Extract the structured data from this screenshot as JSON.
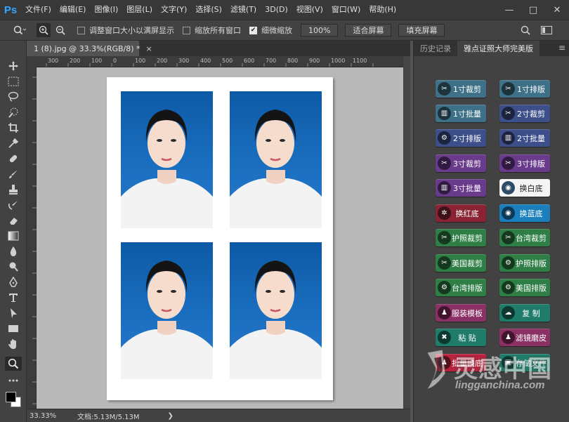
{
  "app": {
    "logo": "Ps"
  },
  "menu": [
    "文件(F)",
    "编辑(E)",
    "图像(I)",
    "图层(L)",
    "文字(Y)",
    "选择(S)",
    "滤镜(T)",
    "3D(D)",
    "视图(V)",
    "窗口(W)",
    "帮助(H)"
  ],
  "window_controls": {
    "minimize": "—",
    "maximize": "□",
    "close": "✕"
  },
  "options": {
    "resize_windows_label": "调整窗口大小以满屏显示",
    "zoom_all_label": "缩放所有窗口",
    "scrubby_zoom_label": "细微缩放",
    "zoom_100": "100%",
    "fit_screen": "适合屏幕",
    "fill_screen": "填充屏幕"
  },
  "document": {
    "tab_title": "1 (8).jpg @ 33.3%(RGB/8) *",
    "close": "×"
  },
  "ruler_ticks": [
    "300",
    "200",
    "100",
    "0",
    "100",
    "200",
    "300",
    "400",
    "500",
    "600",
    "700",
    "800",
    "900",
    "1000",
    "1100"
  ],
  "status": {
    "zoom": "33.33%",
    "doc_info": "文档:5.13M/5.13M",
    "arrow": "❯"
  },
  "panel": {
    "tabs": [
      "历史记录",
      "雅点证照大师完美版"
    ],
    "menu_icon": "≡",
    "buttons": [
      {
        "label": "1寸裁剪",
        "icon": "✂",
        "color": "#3e7188"
      },
      {
        "label": "1寸排版",
        "icon": "✂",
        "color": "#3e7188"
      },
      {
        "label": "1寸批量",
        "icon": "▥",
        "color": "#3e7188"
      },
      {
        "label": "2寸裁剪",
        "icon": "✂",
        "color": "#3c4f8a"
      },
      {
        "label": "2寸排版",
        "icon": "⚙",
        "color": "#3c4f8a"
      },
      {
        "label": "2寸批量",
        "icon": "▥",
        "color": "#3c4f8a"
      },
      {
        "label": "3寸裁剪",
        "icon": "✂",
        "color": "#6a3a8c"
      },
      {
        "label": "3寸排版",
        "icon": "✂",
        "color": "#6a3a8c"
      },
      {
        "label": "3寸批量",
        "icon": "▥",
        "color": "#6a3a8c"
      },
      {
        "label": "换白底",
        "icon": "◉",
        "color": "#f4f4f4"
      },
      {
        "label": "换红底",
        "icon": "✲",
        "color": "#8a2434"
      },
      {
        "label": "换蓝底",
        "icon": "◉",
        "color": "#1b7fbe"
      },
      {
        "label": "护照裁剪",
        "icon": "✂",
        "color": "#2f7e45"
      },
      {
        "label": "台湾裁剪",
        "icon": "✂",
        "color": "#2f7e45"
      },
      {
        "label": "美国裁剪",
        "icon": "✂",
        "color": "#2f7e45"
      },
      {
        "label": "护照排版",
        "icon": "⚙",
        "color": "#2f7e45"
      },
      {
        "label": "台湾排版",
        "icon": "⚙",
        "color": "#2f7e45"
      },
      {
        "label": "美国排版",
        "icon": "⚙",
        "color": "#2f7e45"
      },
      {
        "label": "服装模板",
        "icon": "♟",
        "color": "#8a3064"
      },
      {
        "label": "复 制",
        "icon": "☁",
        "color": "#1f7c6a"
      },
      {
        "label": "粘 贴",
        "icon": "✖",
        "color": "#1f7c6a"
      },
      {
        "label": "滤镜磨皮",
        "icon": "♟",
        "color": "#8a3064"
      },
      {
        "label": "批量换底",
        "icon": "♟",
        "color": "#b8223c"
      },
      {
        "label": "存储文件",
        "icon": "▣",
        "color": "#1f7c6a"
      }
    ]
  },
  "watermark": {
    "cn": "灵感中国",
    "url": "lingganchina.com"
  },
  "colors": {
    "accent": "#31a8ff",
    "canvas_bg": "#b8b8b8",
    "photo_bg": "#1b6fc0"
  }
}
